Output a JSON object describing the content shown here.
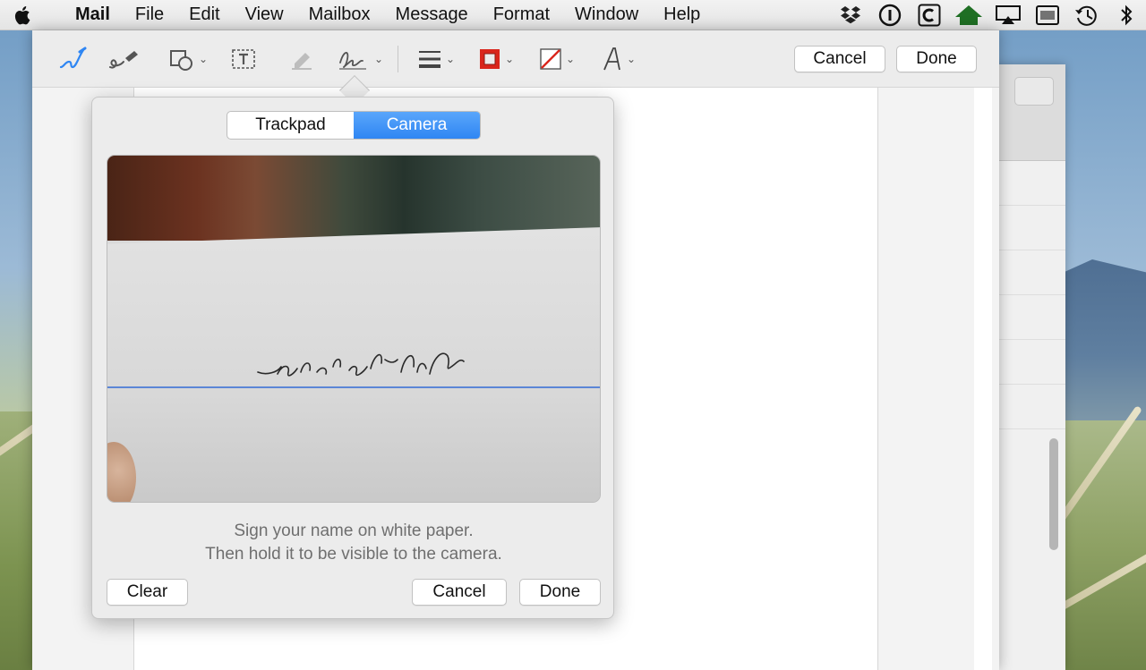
{
  "menubar": {
    "app_name": "Mail",
    "items": [
      "File",
      "Edit",
      "View",
      "Mailbox",
      "Message",
      "Format",
      "Window",
      "Help"
    ],
    "status_icons": [
      "dropbox-icon",
      "1password-icon",
      "c-app-icon",
      "home-icon",
      "airplay-icon",
      "keyboard-viewer-icon",
      "time-machine-icon",
      "bluetooth-icon"
    ]
  },
  "toolbar": {
    "cancel_label": "Cancel",
    "done_label": "Done",
    "tools": [
      "sketch-tool",
      "draw-tool",
      "shapes-tool",
      "text-tool",
      "highlight-tool",
      "sign-tool",
      "line-style-tool",
      "border-color-tool",
      "fill-color-tool",
      "text-style-tool"
    ],
    "border_color": "#d9261c",
    "fill_color": "#d9261c"
  },
  "signature_popover": {
    "tabs": [
      "Trackpad",
      "Camera"
    ],
    "selected_tab": "Camera",
    "instruction_line1": "Sign your name on white paper.",
    "instruction_line2": "Then hold it to be visible to the camera.",
    "clear_label": "Clear",
    "cancel_label": "Cancel",
    "done_label": "Done",
    "accent_color": "#2f86f3"
  }
}
